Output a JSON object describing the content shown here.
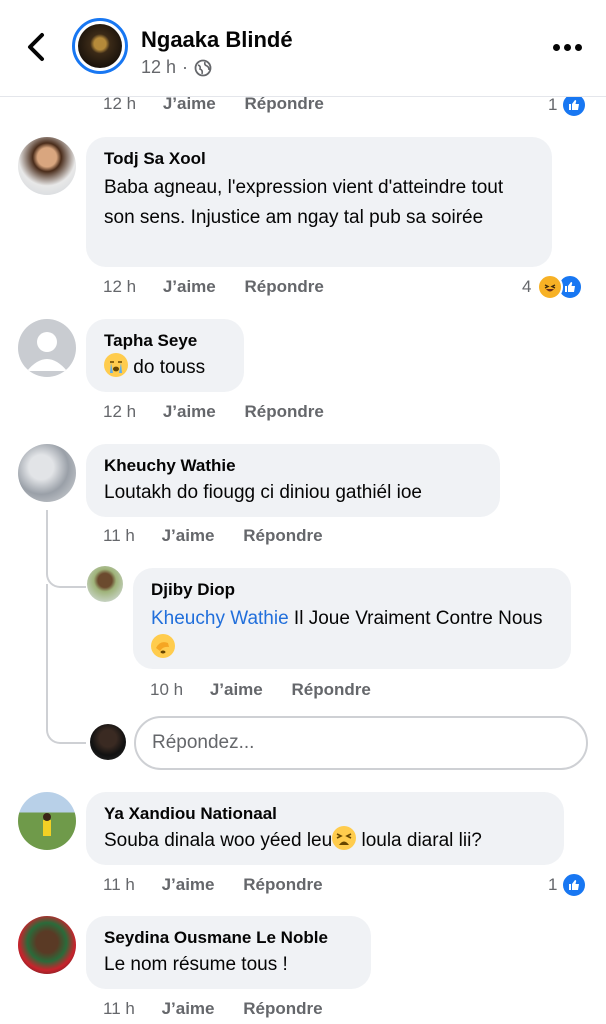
{
  "header": {
    "page_name": "Ngaaka Blindé",
    "time": "12 h",
    "dot": "·",
    "privacy_icon": "globe-icon"
  },
  "top_actions": {
    "time": "12 h",
    "like": "J’aime",
    "reply": "Répondre",
    "reaction_count": "1"
  },
  "comments": [
    {
      "author": "Todj Sa Xool",
      "text": "Baba agneau, l'expression vient d'atteindre tout son sens. Injustice am ngay tal pub sa soirée",
      "time": "12 h",
      "like": "J’aime",
      "reply": "Répondre",
      "reaction_count": "4"
    },
    {
      "author": "Tapha Seye",
      "text": "do touss",
      "time": "12 h",
      "like": "J’aime",
      "reply": "Répondre"
    },
    {
      "author": "Kheuchy Wathie",
      "text": "Loutakh do fiougg ci diniou gathiél ioe",
      "time": "11 h",
      "like": "J’aime",
      "reply": "Répondre"
    },
    {
      "author": "Ya Xandiou Nationaal",
      "text_before": "Souba dinala woo yéed leu",
      "text_after": " loula diaral lii?",
      "time": "11 h",
      "like": "J’aime",
      "reply": "Répondre",
      "reaction_count": "1"
    },
    {
      "author": "Seydina Ousmane Le Noble",
      "text": "Le nom résume tous !",
      "time": "11 h",
      "like": "J’aime",
      "reply": "Répondre"
    }
  ],
  "reply": {
    "author": "Djiby Diop",
    "mention": "Kheuchy Wathie",
    "text": " Il Joue Vraiment Contre Nous",
    "time": "10 h",
    "like": "J’aime",
    "reply": "Répondre"
  },
  "reply_input": {
    "placeholder": "Répondez..."
  },
  "colors": {
    "accent": "#1877f2",
    "bubble": "#f0f2f5",
    "muted": "#65676b"
  }
}
